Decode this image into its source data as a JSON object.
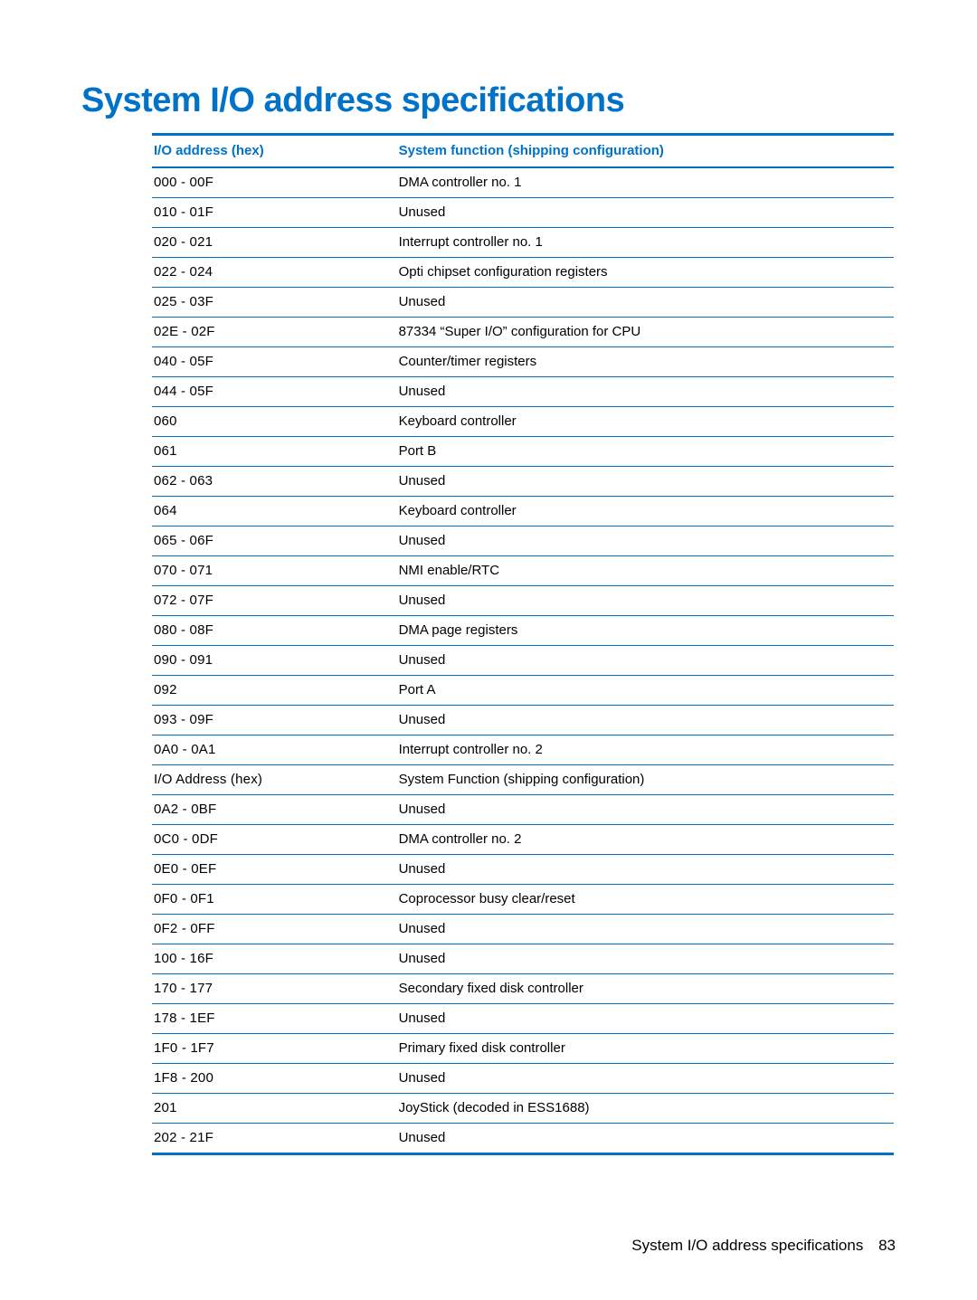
{
  "title": "System I/O address specifications",
  "table": {
    "header_addr": "I/O address (hex)",
    "header_func": "System function (shipping configuration)",
    "rows": [
      {
        "addr": "000 - 00F",
        "func": "DMA controller no. 1"
      },
      {
        "addr": "010 - 01F",
        "func": "Unused"
      },
      {
        "addr": "020 - 021",
        "func": "Interrupt controller no. 1"
      },
      {
        "addr": "022 - 024",
        "func": "Opti chipset configuration registers"
      },
      {
        "addr": "025 - 03F",
        "func": "Unused"
      },
      {
        "addr": "02E - 02F",
        "func": "87334 “Super I/O” configuration for CPU"
      },
      {
        "addr": "040 - 05F",
        "func": "Counter/timer registers"
      },
      {
        "addr": "044 - 05F",
        "func": "Unused"
      },
      {
        "addr": "060",
        "func": "Keyboard controller"
      },
      {
        "addr": "061",
        "func": "Port B"
      },
      {
        "addr": "062 - 063",
        "func": "Unused"
      },
      {
        "addr": "064",
        "func": "Keyboard controller"
      },
      {
        "addr": "065 - 06F",
        "func": "Unused"
      },
      {
        "addr": "070 - 071",
        "func": "NMI enable/RTC"
      },
      {
        "addr": "072 - 07F",
        "func": "Unused"
      },
      {
        "addr": "080 - 08F",
        "func": "DMA page registers"
      },
      {
        "addr": "090 - 091",
        "func": "Unused"
      },
      {
        "addr": "092",
        "func": "Port A"
      },
      {
        "addr": "093 - 09F",
        "func": "Unused"
      },
      {
        "addr": "0A0 - 0A1",
        "func": "Interrupt controller no. 2"
      },
      {
        "addr": "I/O Address (hex)",
        "func": "System Function (shipping configuration)"
      },
      {
        "addr": "0A2 - 0BF",
        "func": "Unused"
      },
      {
        "addr": "0C0 - 0DF",
        "func": "DMA controller no. 2"
      },
      {
        "addr": "0E0 - 0EF",
        "func": "Unused"
      },
      {
        "addr": "0F0 - 0F1",
        "func": "Coprocessor busy clear/reset"
      },
      {
        "addr": "0F2 - 0FF",
        "func": "Unused"
      },
      {
        "addr": "100 - 16F",
        "func": "Unused"
      },
      {
        "addr": "170 - 177",
        "func": "Secondary fixed disk controller"
      },
      {
        "addr": "178 - 1EF",
        "func": "Unused"
      },
      {
        "addr": "1F0 - 1F7",
        "func": "Primary fixed disk controller"
      },
      {
        "addr": "1F8 - 200",
        "func": "Unused"
      },
      {
        "addr": "201",
        "func": "JoyStick (decoded in ESS1688)"
      },
      {
        "addr": "202 - 21F",
        "func": "Unused"
      }
    ]
  },
  "footer": {
    "text": "System I/O address specifications",
    "page": "83"
  }
}
